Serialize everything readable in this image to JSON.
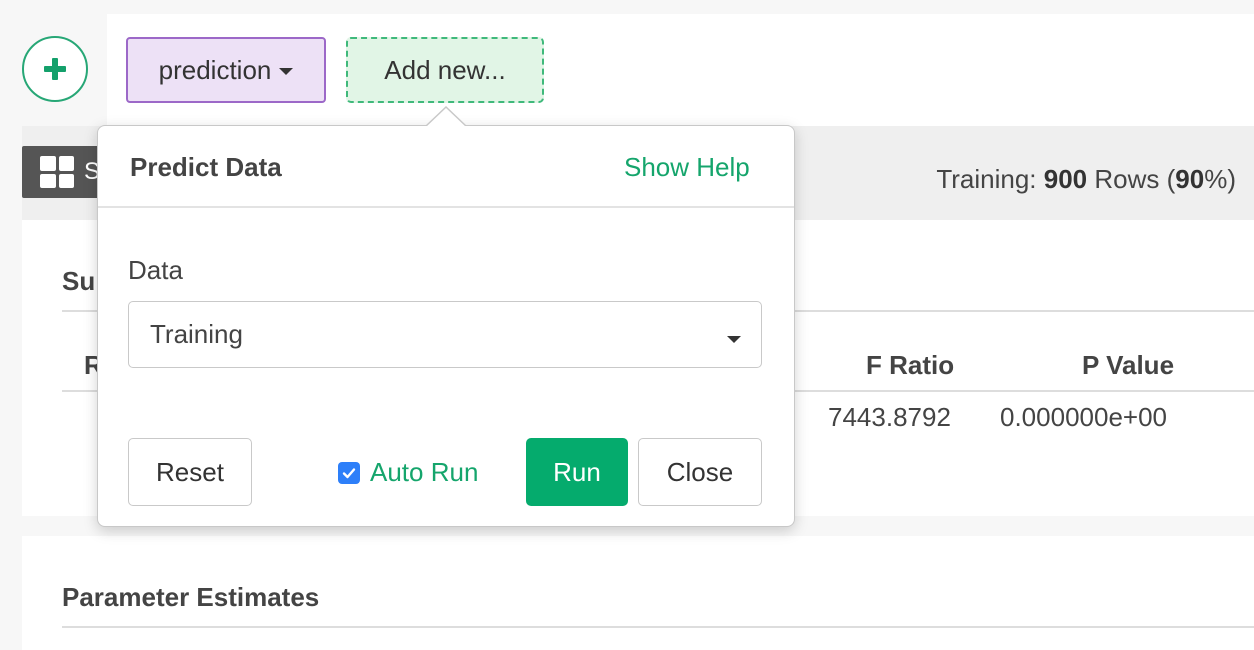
{
  "header": {
    "add_button_symbol": "+",
    "tabs": [
      {
        "label": "prediction"
      },
      {
        "label": "Add new..."
      }
    ]
  },
  "toolbar": {
    "view_button_partial": "S",
    "training_label": "Training:",
    "training_rows": "900",
    "training_rows_unit": "Rows (",
    "training_percent": "90",
    "training_percent_suffix": "%)"
  },
  "summary": {
    "title_partial": "Su",
    "column_partial": "R",
    "columns": [
      "F Ratio",
      "P Value"
    ],
    "row": {
      "f_ratio": "7443.8792",
      "p_value": "0.000000e+00"
    }
  },
  "parameter_estimates": {
    "title": "Parameter Estimates"
  },
  "popover": {
    "title": "Predict Data",
    "help_link": "Show Help",
    "data_label": "Data",
    "data_select_value": "Training",
    "reset_label": "Reset",
    "auto_run_label": "Auto Run",
    "auto_run_checked": true,
    "run_label": "Run",
    "close_label": "Close"
  },
  "colors": {
    "accent_green": "#05ab6d",
    "prediction_chip_bg": "#ede1f6",
    "add_new_chip_bg": "#e1f5e6",
    "checkbox_blue": "#2d7ff9"
  }
}
